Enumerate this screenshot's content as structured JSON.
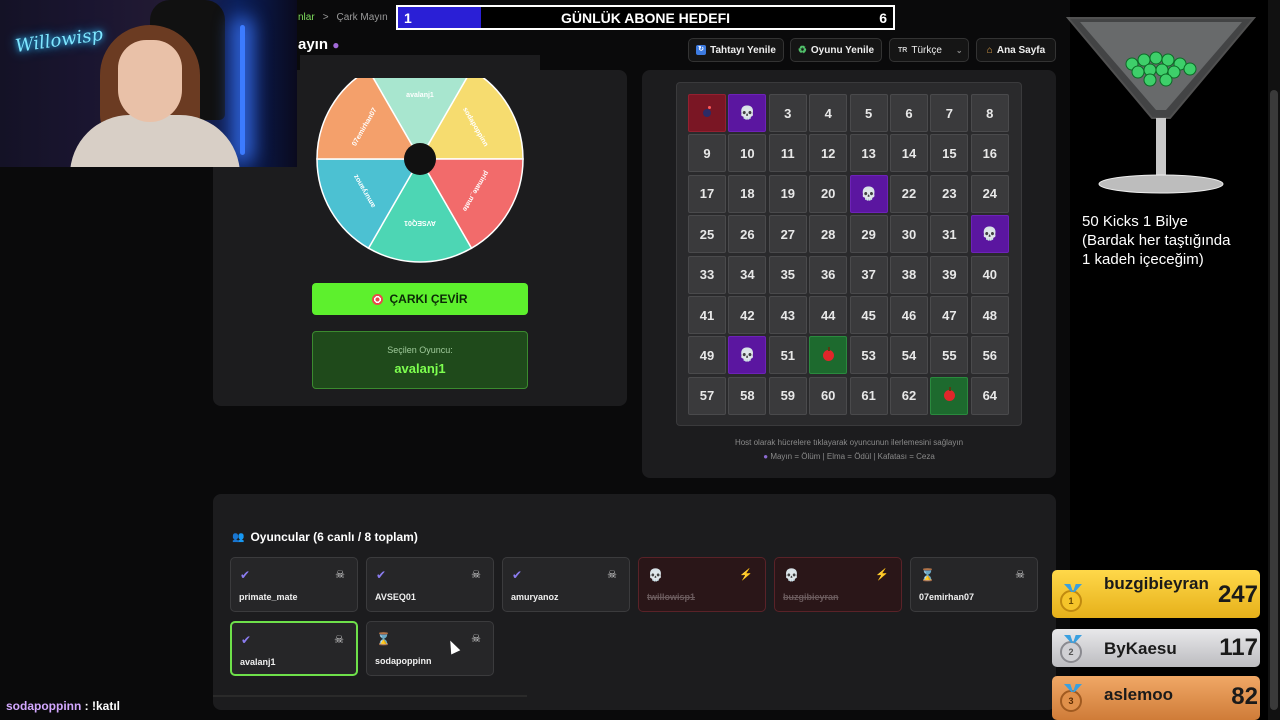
{
  "breadcrumb": {
    "prev": "nlar",
    "sep": ">",
    "current": "Çark Mayın"
  },
  "page_title": "ayın",
  "goal": {
    "current": "1",
    "title": "GÜNLÜK ABONE HEDEFI",
    "target": "6",
    "progress": 0.1667,
    "fill_color": "#2a1fd6"
  },
  "toolbar": {
    "refresh_board": "Tahtayı Yenile",
    "restart_game": "Oyunu Yenile",
    "language_code": "TR",
    "language": "Türkçe",
    "home": "Ana Sayfa"
  },
  "wheel": {
    "segments": [
      {
        "label": "avalanj1",
        "color": "#a8e6cf"
      },
      {
        "label": "sodapoppinn",
        "color": "#f6dc6f"
      },
      {
        "label": "primate_mate",
        "color": "#f26b6b"
      },
      {
        "label": "AVSEQ01",
        "color": "#4dd6b4"
      },
      {
        "label": "amuryanoz",
        "color": "#4cc1d2"
      },
      {
        "label": "07emirhan07",
        "color": "#f4a06b"
      }
    ],
    "spin_label": "ÇARKI ÇEVİR",
    "selected_label": "Seçilen Oyuncu:",
    "selected_value": "avalanj1"
  },
  "board": {
    "cells": [
      {
        "n": "1",
        "state": "mine"
      },
      {
        "n": "2",
        "state": "skull"
      },
      {
        "n": "3",
        "state": "normal"
      },
      {
        "n": "4",
        "state": "normal"
      },
      {
        "n": "5",
        "state": "normal"
      },
      {
        "n": "6",
        "state": "normal"
      },
      {
        "n": "7",
        "state": "normal"
      },
      {
        "n": "8",
        "state": "normal"
      },
      {
        "n": "9",
        "state": "normal"
      },
      {
        "n": "10",
        "state": "normal"
      },
      {
        "n": "11",
        "state": "normal"
      },
      {
        "n": "12",
        "state": "normal"
      },
      {
        "n": "13",
        "state": "normal"
      },
      {
        "n": "14",
        "state": "normal"
      },
      {
        "n": "15",
        "state": "normal"
      },
      {
        "n": "16",
        "state": "normal"
      },
      {
        "n": "17",
        "state": "normal"
      },
      {
        "n": "18",
        "state": "normal"
      },
      {
        "n": "19",
        "state": "normal"
      },
      {
        "n": "20",
        "state": "normal"
      },
      {
        "n": "21",
        "state": "skull"
      },
      {
        "n": "22",
        "state": "normal"
      },
      {
        "n": "23",
        "state": "normal"
      },
      {
        "n": "24",
        "state": "normal"
      },
      {
        "n": "25",
        "state": "normal"
      },
      {
        "n": "26",
        "state": "normal"
      },
      {
        "n": "27",
        "state": "normal"
      },
      {
        "n": "28",
        "state": "normal"
      },
      {
        "n": "29",
        "state": "normal"
      },
      {
        "n": "30",
        "state": "normal"
      },
      {
        "n": "31",
        "state": "normal"
      },
      {
        "n": "32",
        "state": "skull"
      },
      {
        "n": "33",
        "state": "normal"
      },
      {
        "n": "34",
        "state": "normal"
      },
      {
        "n": "35",
        "state": "normal"
      },
      {
        "n": "36",
        "state": "normal"
      },
      {
        "n": "37",
        "state": "normal"
      },
      {
        "n": "38",
        "state": "normal"
      },
      {
        "n": "39",
        "state": "normal"
      },
      {
        "n": "40",
        "state": "normal"
      },
      {
        "n": "41",
        "state": "normal"
      },
      {
        "n": "42",
        "state": "normal"
      },
      {
        "n": "43",
        "state": "normal"
      },
      {
        "n": "44",
        "state": "normal"
      },
      {
        "n": "45",
        "state": "normal"
      },
      {
        "n": "46",
        "state": "normal"
      },
      {
        "n": "47",
        "state": "normal"
      },
      {
        "n": "48",
        "state": "normal"
      },
      {
        "n": "49",
        "state": "normal"
      },
      {
        "n": "50",
        "state": "skull"
      },
      {
        "n": "51",
        "state": "normal"
      },
      {
        "n": "52",
        "state": "apple"
      },
      {
        "n": "53",
        "state": "normal"
      },
      {
        "n": "54",
        "state": "normal"
      },
      {
        "n": "55",
        "state": "normal"
      },
      {
        "n": "56",
        "state": "normal"
      },
      {
        "n": "57",
        "state": "normal"
      },
      {
        "n": "58",
        "state": "normal"
      },
      {
        "n": "59",
        "state": "normal"
      },
      {
        "n": "60",
        "state": "normal"
      },
      {
        "n": "61",
        "state": "normal"
      },
      {
        "n": "62",
        "state": "normal"
      },
      {
        "n": "63",
        "state": "apple"
      },
      {
        "n": "64",
        "state": "normal"
      }
    ],
    "help_line1": "Host olarak hücrelere tıklayarak oyuncunun ilerlemesini sağlayın",
    "help_line2": "Mayın = Ölüm | Elma = Ödül | Kafatası = Ceza",
    "colors": {
      "mine": "#7a1624",
      "skull": "#5b16a0",
      "apple": "#1d6a2e"
    }
  },
  "players": {
    "title": "Oyuncular (6 canlı / 8 toplam)",
    "list": [
      {
        "name": "primate_mate",
        "status": "alive",
        "action": "skip"
      },
      {
        "name": "AVSEQ01",
        "status": "alive",
        "action": "skip"
      },
      {
        "name": "amuryanoz",
        "status": "alive",
        "action": "skip"
      },
      {
        "name": "twillowisp1",
        "status": "dead",
        "action": "revive"
      },
      {
        "name": "buzgibieyran",
        "status": "dead",
        "action": "revive"
      },
      {
        "name": "07emirhan07",
        "status": "waiting",
        "action": "skip"
      },
      {
        "name": "avalanj1",
        "status": "alive",
        "action": "skip",
        "selected": true
      },
      {
        "name": "sodapoppinn",
        "status": "waiting",
        "action": "skip"
      }
    ]
  },
  "chat": {
    "user": "sodapoppinn",
    "message": ": !katıl"
  },
  "overlay": {
    "kicks_line1": "50 Kicks 1 Bilye",
    "kicks_line2": "(Bardak her taştığında",
    "kicks_line3": "1 kadeh içeceğim)",
    "webcam_sign": "Willowisp"
  },
  "leaderboard": [
    {
      "rank": "1",
      "name": "buzgibieyran",
      "score": "247"
    },
    {
      "rank": "2",
      "name": "ByKaesu",
      "score": "117"
    },
    {
      "rank": "3",
      "name": "aslemoo",
      "score": "82"
    }
  ]
}
